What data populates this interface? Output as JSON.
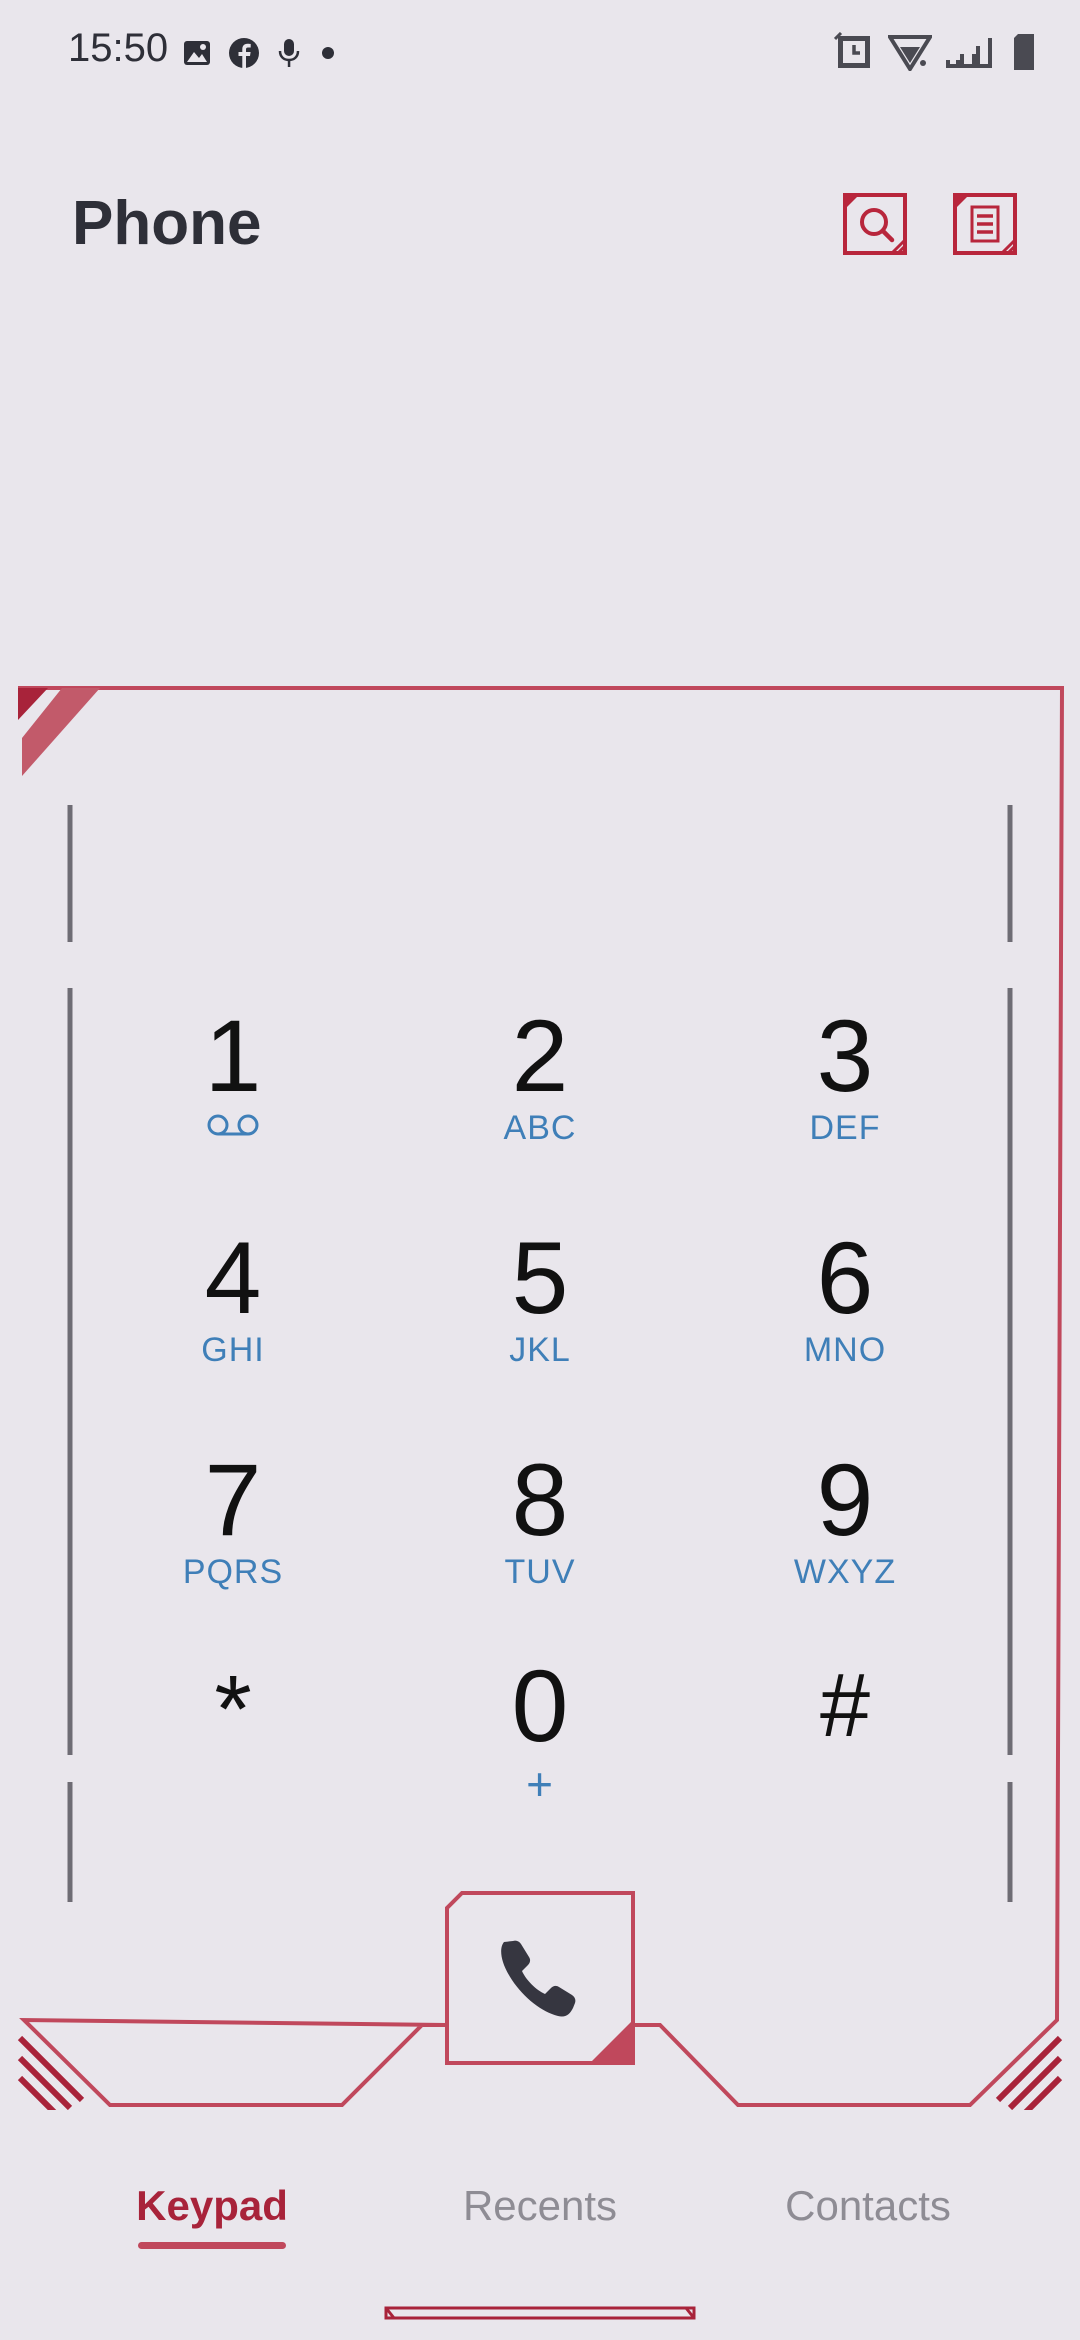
{
  "status_bar": {
    "time": "15:50",
    "left_icons": [
      "image-icon",
      "facebook-icon",
      "microphone-icon",
      "dot-icon"
    ],
    "right_icons": [
      "alarm-icon",
      "wifi-icon",
      "signal-icon",
      "battery-icon"
    ]
  },
  "header": {
    "title": "Phone",
    "search_icon": "search-icon",
    "menu_icon": "menu-icon"
  },
  "keypad": {
    "keys": [
      {
        "digit": "1",
        "letters": "",
        "sub_icon": "voicemail-icon"
      },
      {
        "digit": "2",
        "letters": "ABC"
      },
      {
        "digit": "3",
        "letters": "DEF"
      },
      {
        "digit": "4",
        "letters": "GHI"
      },
      {
        "digit": "5",
        "letters": "JKL"
      },
      {
        "digit": "6",
        "letters": "MNO"
      },
      {
        "digit": "7",
        "letters": "PQRS"
      },
      {
        "digit": "8",
        "letters": "TUV"
      },
      {
        "digit": "9",
        "letters": "WXYZ"
      },
      {
        "digit": "*",
        "letters": ""
      },
      {
        "digit": "0",
        "letters": "+"
      },
      {
        "digit": "#",
        "letters": ""
      }
    ],
    "call_icon": "phone-icon"
  },
  "nav": {
    "tabs": [
      {
        "label": "Keypad",
        "active": true
      },
      {
        "label": "Recents",
        "active": false
      },
      {
        "label": "Contacts",
        "active": false
      }
    ]
  },
  "colors": {
    "accent": "#c0485c",
    "accent_dark": "#a8233a",
    "background": "#e9e6ec",
    "letters": "#3f7fb8",
    "text": "#2e2f38"
  }
}
